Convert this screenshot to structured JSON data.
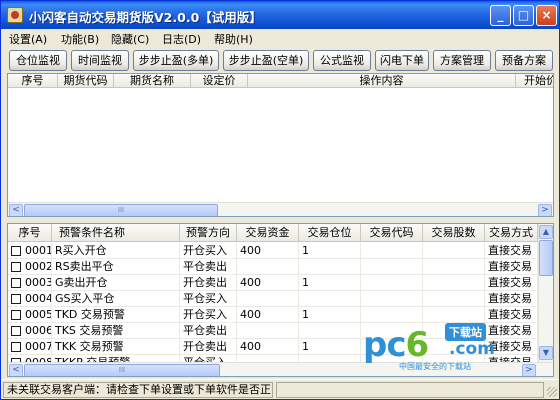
{
  "window": {
    "title": "小闪客自动交易期货版V2.0.0【试用版】"
  },
  "titlebar": {
    "minimize": "_",
    "maximize": "□",
    "close": "×"
  },
  "menu": [
    "设置(A)",
    "功能(B)",
    "隐藏(C)",
    "日志(D)",
    "帮助(H)"
  ],
  "toolbar": [
    "仓位监视",
    "时间监视",
    "步步止盈(多单)",
    "步步止盈(空单)",
    "公式监视",
    "闪电下单",
    "方案管理",
    "预备方案"
  ],
  "top_grid": {
    "columns": [
      "序号",
      "期货代码",
      "期货名称",
      "设定价",
      "操作内容",
      "开始价"
    ],
    "scroll_left": "<",
    "scroll_right": ">",
    "thumb": "III"
  },
  "bottom_grid": {
    "columns": [
      "序号",
      "预警条件名称",
      "预警方向",
      "交易资金",
      "交易仓位",
      "交易代码",
      "交易股数",
      "交易方式"
    ],
    "rows": [
      {
        "id": "0001",
        "name": "R买入开仓",
        "direction": "开仓买入",
        "capital": "400",
        "position": "1",
        "code": "",
        "shares": "",
        "mode": "直接交易"
      },
      {
        "id": "0002",
        "name": "RS卖出平仓",
        "direction": "平仓卖出",
        "capital": "",
        "position": "",
        "code": "",
        "shares": "",
        "mode": "直接交易"
      },
      {
        "id": "0003",
        "name": "G卖出开仓",
        "direction": "开仓卖出",
        "capital": "400",
        "position": "1",
        "code": "",
        "shares": "",
        "mode": "直接交易"
      },
      {
        "id": "0004",
        "name": "GS买入平仓",
        "direction": "平仓买入",
        "capital": "",
        "position": "",
        "code": "",
        "shares": "",
        "mode": "直接交易"
      },
      {
        "id": "0005",
        "name": "TKD 交易预警",
        "direction": "开仓买入",
        "capital": "400",
        "position": "1",
        "code": "",
        "shares": "",
        "mode": "直接交易"
      },
      {
        "id": "0006",
        "name": "TKS 交易预警",
        "direction": "平仓卖出",
        "capital": "",
        "position": "",
        "code": "",
        "shares": "",
        "mode": "直接交易"
      },
      {
        "id": "0007",
        "name": "TKK 交易预警",
        "direction": "开仓卖出",
        "capital": "400",
        "position": "1",
        "code": "",
        "shares": "",
        "mode": "直接交易"
      },
      {
        "id": "0008",
        "name": "TKKP 交易预警",
        "direction": "平仓买入",
        "capital": "",
        "position": "",
        "code": "",
        "shares": "",
        "mode": "直接交易"
      }
    ],
    "scroll_up": "▲",
    "scroll_down": "▼",
    "scroll_left": "<",
    "scroll_right": ">",
    "thumb": "III"
  },
  "status": {
    "message": "未关联交易客户端：请检查下单设置或下单软件是否正常打开"
  },
  "watermark": {
    "brand_pc": "pc",
    "brand_six": "6",
    "tag": "下载站",
    "com": ".com",
    "slogan": "中国最安全的下载站"
  }
}
